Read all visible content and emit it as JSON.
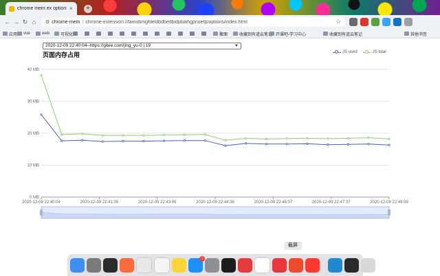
{
  "browser": {
    "tab_title": "chrome mem ex options",
    "tab_close": "×",
    "new_tab": "+",
    "nav": {
      "back": "←",
      "forward": "→",
      "reload": "↻",
      "home": "⌂"
    },
    "omnibox": {
      "site": "chrome-mem",
      "url": "chrome-extension://famobmgfdeldbdbedbidpbaihgpnoefp/options/index.html"
    },
    "extension_colors": [
      "#6b6b6b",
      "#e0352b",
      "#5aa23a",
      "#3ba4ff",
      "#1673c3",
      "#9aa0a6"
    ],
    "bookmarks": [
      "应用",
      "vue",
      "web",
      "可视化",
      "",
      "",
      "",
      "",
      "",
      "",
      "",
      "",
      "",
      "",
      "",
      "",
      "聚面",
      "收藏到有道云笔记",
      "开课吧-学习中心",
      "收藏到有道云笔记",
      "其他书签"
    ]
  },
  "page": {
    "select_value": "2020-12-09 22:40:04--https://gitee.com/jing_yu-0 | 19",
    "title": "页面内存占用"
  },
  "chart_data": {
    "type": "line",
    "x": [
      "2020-12-09 22:40:04",
      "",
      "",
      "",
      "",
      "",
      "",
      "",
      "",
      "",
      "",
      "",
      "2020-12-09 22:49:09"
    ],
    "x_ticks": [
      "2020-12-09 22:40:04",
      "2020-12-09 22:41:35",
      "2020-12-09 22:43:06",
      "2020-12-09 22:44:36",
      "2020-12-09 22:46:07",
      "2020-12-09 22:47:37",
      "2020-12-09 22:49:09"
    ],
    "series": [
      {
        "name": "JS used",
        "color": "#4a5fc1",
        "values": [
          25.8,
          17.6,
          17.8,
          17.4,
          17.5,
          17.5,
          17.6,
          17.7,
          17.7,
          16.1,
          16.8,
          16.6,
          16.6,
          16.7,
          16.4,
          16.5,
          16.6,
          16.3
        ]
      },
      {
        "name": "JS total",
        "color": "#91cc75",
        "values": [
          38.2,
          19.6,
          19.8,
          19.3,
          19.3,
          19.3,
          19.4,
          19.5,
          19.6,
          17.8,
          18.4,
          18.2,
          18.3,
          18.4,
          18.3,
          18.4,
          18.6,
          18.2
        ]
      }
    ],
    "y_ticks": [
      "0 MB",
      "10 MB",
      "20 MB",
      "30 MB",
      "40 MB"
    ],
    "ylim": [
      0,
      40
    ],
    "grid": true,
    "legend_position": "top-right",
    "has_zoom_slider": true
  },
  "dock": {
    "tooltip": "截屏",
    "app_colors": [
      "#3f8ef0",
      "#7a7a7a",
      "#2b2b2b",
      "#ff6a3d",
      "#e8e8e8",
      "#f5f5f5",
      "#ffd43b",
      "#1d90ff",
      "#8e8e93",
      "#1c1c1c",
      "#e23c3c",
      "#ffffff",
      "#e7373d",
      "#ee4b2b",
      "#ff3b30",
      "#4a4a4a",
      "#1f8ad2",
      "#2a2a2a",
      "#d8d8d8"
    ],
    "badge": "1"
  }
}
